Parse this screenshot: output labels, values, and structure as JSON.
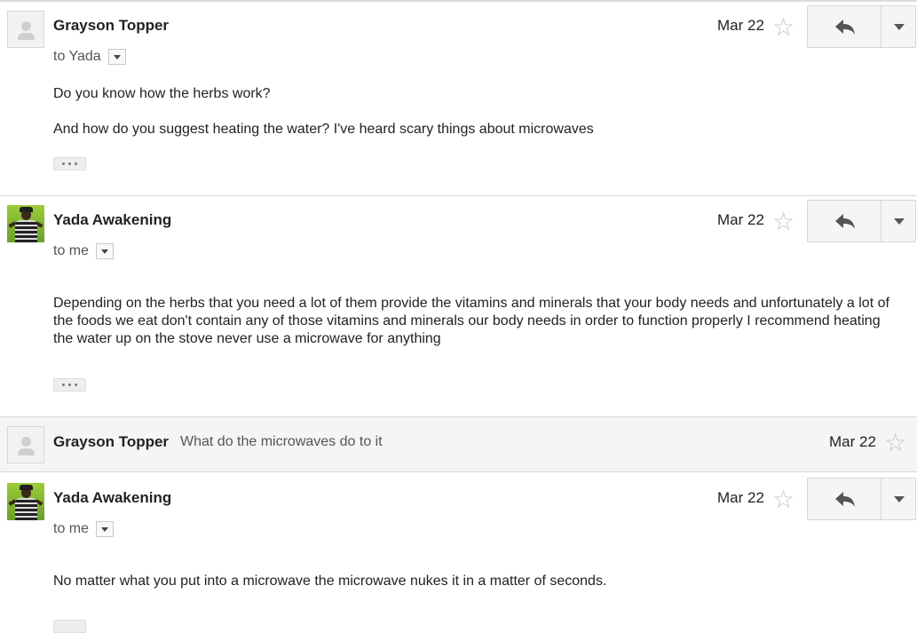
{
  "messages": [
    {
      "sender": "Grayson Topper",
      "recipient": "to Yada",
      "date": "Mar 22",
      "body": [
        "Do you know how the herbs work?",
        "And how do you suggest heating the water? I've heard scary things about microwaves"
      ],
      "avatar": "default-person-icon"
    },
    {
      "sender": "Yada Awakening",
      "recipient": "to me",
      "date": "Mar 22",
      "body": [
        "Depending on the herbs that you need a lot of them provide the vitamins and minerals that your body needs and unfortunately a lot of the foods we eat don't contain any of those vitamins and minerals our body needs in order to function properly I recommend heating the water up on the stove never use a microwave for anything"
      ],
      "avatar": "photo"
    },
    {
      "sender": "Grayson Topper",
      "snippet": "What do the microwaves do to it",
      "date": "Mar 22",
      "collapsed": true,
      "avatar": "default-person-icon"
    },
    {
      "sender": "Yada Awakening",
      "recipient": "to me",
      "date": "Mar 22",
      "body": [
        "No matter what you put into a microwave the microwave nukes it in a matter of seconds."
      ],
      "avatar": "photo"
    }
  ],
  "icons": {
    "star": "star-icon",
    "reply": "reply-icon",
    "more": "chevron-down-icon",
    "expand": "ellipsis-icon"
  }
}
